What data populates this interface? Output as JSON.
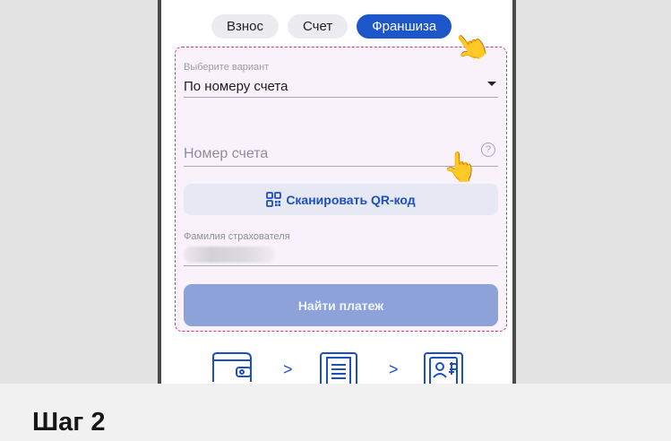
{
  "tabs": [
    {
      "label": "Взнос",
      "active": false
    },
    {
      "label": "Счет",
      "active": false
    },
    {
      "label": "Франшиза",
      "active": true
    }
  ],
  "form": {
    "select_label": "Выберите вариант",
    "select_value": "По номеру счета",
    "account_placeholder": "Номер счета",
    "help_icon_glyph": "?",
    "qr_button_label": "Сканировать QR-код",
    "surname_label": "Фамилия страхователя",
    "find_button_label": "Найти платеж"
  },
  "steps": {
    "chevron": ">",
    "icons": [
      "wallet-icon",
      "receipt-icon",
      "person-card-icon"
    ]
  },
  "hands": [
    "pointing-hand-icon",
    "pointing-hand-icon"
  ],
  "caption": "Шаг 2",
  "colors": {
    "accent": "#1d56c9",
    "dashed_border": "#d4367e",
    "find_button": "#8ca2d8"
  }
}
